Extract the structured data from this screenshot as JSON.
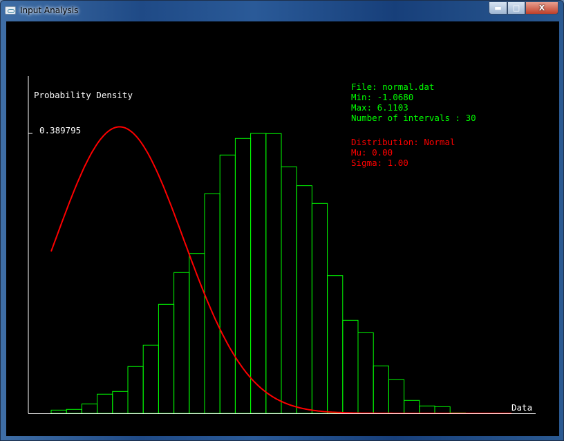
{
  "window": {
    "title": "Input Analysis",
    "icon": "app-icon",
    "controls": [
      "minimize",
      "maximize",
      "close"
    ]
  },
  "info": {
    "file": "File: normal.dat",
    "min": "Min: -1.0680",
    "max": "Max: 6.1103",
    "intervals": "Number of intervals : 30",
    "distribution": "Distribution: Normal",
    "mu": "Mu: 0.00",
    "sigma": "Sigma: 1.00",
    "info_color": "#00ff00",
    "fit_color": "#ff0000"
  },
  "chart_data": {
    "type": "bar",
    "title": "",
    "ylabel": "Probability Density",
    "xlabel": "Data",
    "y_tick_label": "0.389795",
    "ylim": [
      0,
      0.389795
    ],
    "xlim": [
      -1.068,
      6.1103
    ],
    "bins": 30,
    "bar_color": "#00ff00",
    "curve_color": "#ff0000",
    "axis_color": "#ffffff",
    "values": [
      0.0045,
      0.0055,
      0.0132,
      0.0267,
      0.0305,
      0.0652,
      0.095,
      0.1518,
      0.1961,
      0.2226,
      0.3058,
      0.3597,
      0.3828,
      0.3898,
      0.3895,
      0.3433,
      0.317,
      0.2923,
      0.1918,
      0.1296,
      0.1123,
      0.0661,
      0.0469,
      0.018,
      0.0103,
      0.0093,
      0.0007,
      0,
      0,
      0
    ],
    "series": [
      {
        "type": "line",
        "distribution": "normal",
        "mu": 0.0,
        "sigma": 1.0
      }
    ]
  }
}
